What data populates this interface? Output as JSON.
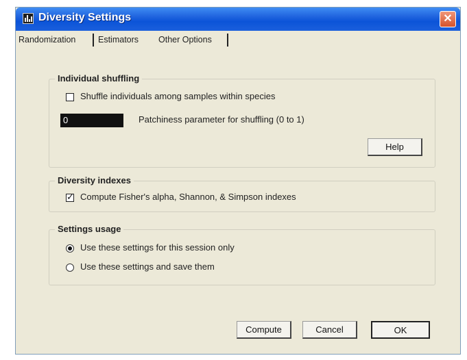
{
  "window": {
    "title": "Diversity Settings",
    "close_glyph": "✕"
  },
  "tabs": [
    {
      "label": "Randomization"
    },
    {
      "label": "Estimators"
    },
    {
      "label": "Other Options",
      "active": true
    }
  ],
  "individual_shuffling": {
    "legend": "Individual shuffling",
    "shuffle_checkbox": {
      "label": "Shuffle individuals among samples within species",
      "checked": false
    },
    "patchiness": {
      "value": "0",
      "label": "Patchiness parameter for shuffling (0 to 1)"
    },
    "help_label": "Help"
  },
  "diversity_indexes": {
    "legend": "Diversity indexes",
    "compute_checkbox": {
      "label": "Compute Fisher's alpha, Shannon, & Simpson indexes",
      "checked": true
    }
  },
  "settings_usage": {
    "legend": "Settings usage",
    "options": [
      {
        "label": "Use these settings for this session only",
        "selected": true
      },
      {
        "label": "Use these settings and save them",
        "selected": false
      }
    ]
  },
  "buttons": {
    "compute": "Compute",
    "cancel": "Cancel",
    "ok": "OK"
  },
  "icons": {
    "app": "histogram-app-icon",
    "close": "close-icon"
  },
  "colors": {
    "titlebar": "#0b54d8",
    "close": "#d5522b",
    "dialog_bg": "#ece9d8"
  }
}
